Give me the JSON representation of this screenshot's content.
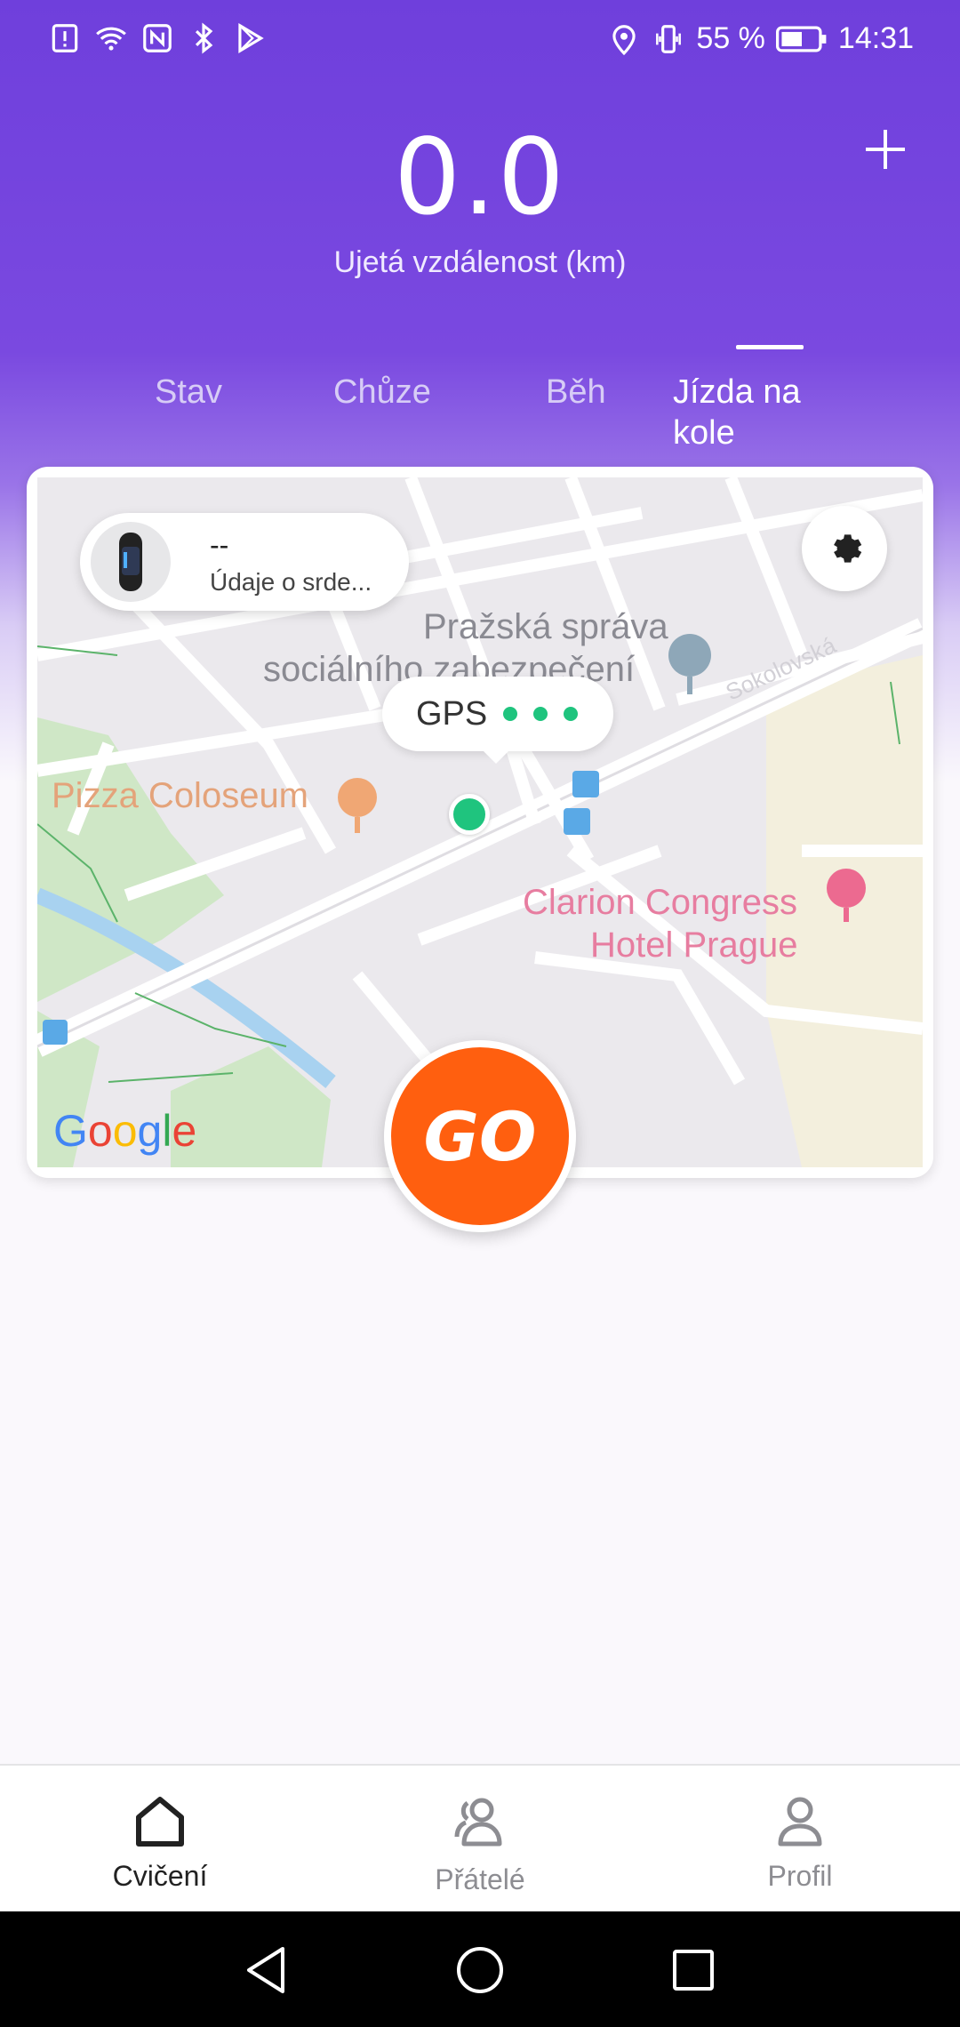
{
  "status_bar": {
    "battery": "55 %",
    "time": "14:31",
    "left_icons": [
      "alert-icon",
      "wifi-icon",
      "nfc-icon",
      "bluetooth-icon",
      "play-store-icon"
    ],
    "right_icons": [
      "location-icon",
      "vibrate-icon",
      "battery-icon"
    ]
  },
  "header": {
    "distance_value": "0.0",
    "distance_label": "Ujetá vzdálenost (km)",
    "add_icon": "plus-icon"
  },
  "tabs": [
    {
      "label": "Stav",
      "active": false
    },
    {
      "label": "Chůze",
      "active": false
    },
    {
      "label": "Běh",
      "active": false
    },
    {
      "label": "Jízda na kole",
      "active": true
    }
  ],
  "map": {
    "heart_rate_value": "--",
    "heart_rate_label": "Údaje o srde...",
    "gps_label": "GPS",
    "settings_icon": "gear-icon",
    "places": {
      "office": "Pražská správa sociálního zabezpečení",
      "office_line1": "Pražská správa",
      "office_line2": "sociálního zabezpečení",
      "pizza": "Pizza Coloseum",
      "hotel_line1": "Clarion Congress",
      "hotel_line2": "Hotel Prague",
      "street": "Sokolovská"
    },
    "attribution": "Google"
  },
  "go_button": {
    "label": "GO",
    "color": "#ff5f0f"
  },
  "bottom_nav": [
    {
      "label": "Cvičení",
      "icon": "home-icon",
      "active": true
    },
    {
      "label": "Přátelé",
      "icon": "friends-icon",
      "active": false
    },
    {
      "label": "Profil",
      "icon": "profile-icon",
      "active": false
    }
  ],
  "colors": {
    "accent": "#7343dc",
    "gps_dot": "#1fc47e",
    "go": "#ff5f0f"
  }
}
